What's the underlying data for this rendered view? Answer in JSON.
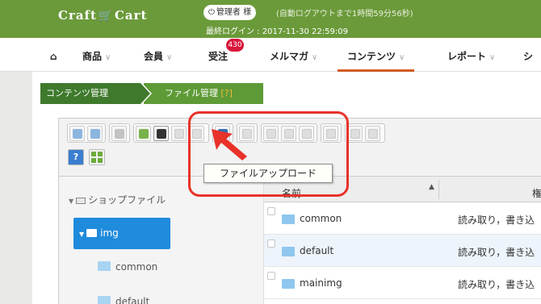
{
  "header": {
    "logo_text_left": "Craft",
    "logo_text_right": "Cart",
    "user_label": "管理者 様",
    "session_text": "(自動ログアウトまで1時間59分56秒)",
    "last_login": "最終ログイン : 2017-11-30 22:59:09",
    "color": "#6b9a3a"
  },
  "nav": {
    "home_icon": "home-icon",
    "items": [
      {
        "label": "商品",
        "has_dropdown": true
      },
      {
        "label": "会員",
        "has_dropdown": true
      },
      {
        "label": "受注",
        "has_dropdown": false,
        "badge": "430"
      },
      {
        "label": "メルマガ",
        "has_dropdown": true
      },
      {
        "label": "コンテンツ",
        "has_dropdown": true,
        "active": true
      },
      {
        "label": "レポート",
        "has_dropdown": true
      },
      {
        "label": "シ"
      }
    ],
    "accent": "#d05a20"
  },
  "breadcrumb": {
    "items": [
      "コンテンツ管理",
      "ファイル管理"
    ],
    "help": "[?]"
  },
  "toolbar": {
    "tooltip": "ファイルアップロード"
  },
  "tree": {
    "root": "ショップファイル",
    "selected": "img",
    "children": [
      "common",
      "default"
    ]
  },
  "list": {
    "columns": {
      "name": "名前",
      "permission": "権"
    },
    "rows": [
      {
        "name": "common",
        "permission": "読み取り，書き込"
      },
      {
        "name": "default",
        "permission": "読み取り，書き込"
      },
      {
        "name": "mainimg",
        "permission": "読み取り，書き込"
      }
    ]
  },
  "annotation_color": "#e8322a"
}
